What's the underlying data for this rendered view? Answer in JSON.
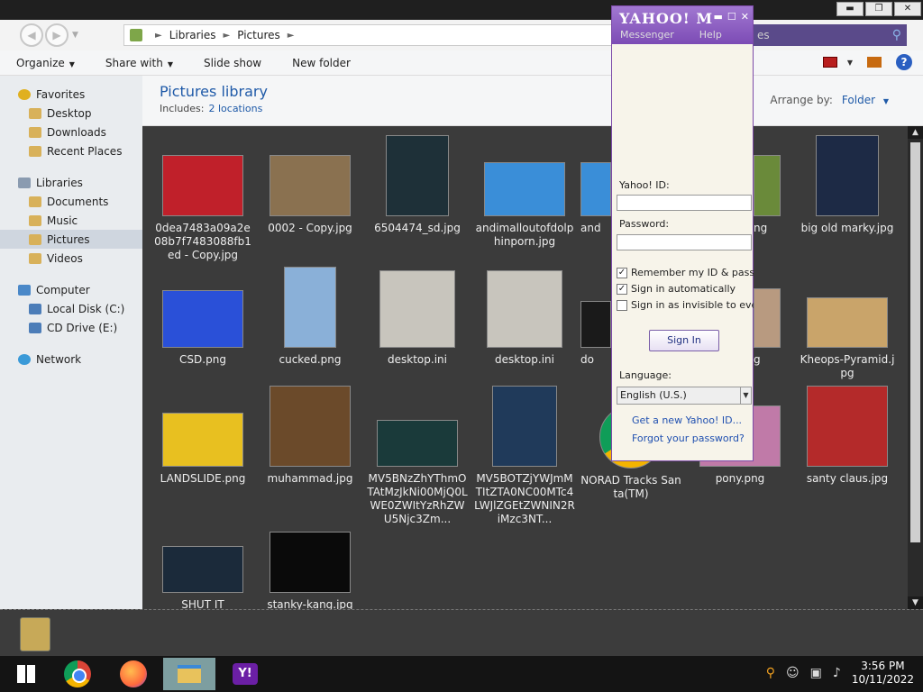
{
  "titlebar": {
    "minimize": "▬",
    "maximize": "❐",
    "close": "✕"
  },
  "address": {
    "crumbs": [
      "Libraries",
      "Pictures"
    ],
    "sep": "►"
  },
  "search": {
    "placeholder_tail": "es"
  },
  "toolbar": {
    "organize": "Organize",
    "share_with": "Share with",
    "slide_show": "Slide show",
    "new_folder": "New folder",
    "help": "?"
  },
  "sidebar": {
    "favorites": {
      "label": "Favorites",
      "items": [
        "Desktop",
        "Downloads",
        "Recent Places"
      ]
    },
    "libraries": {
      "label": "Libraries",
      "items": [
        "Documents",
        "Music",
        "Pictures",
        "Videos"
      ]
    },
    "computer": {
      "label": "Computer",
      "items": [
        "Local Disk (C:)",
        "CD Drive (E:)"
      ]
    },
    "network": {
      "label": "Network"
    }
  },
  "library": {
    "title": "Pictures library",
    "includes": "Includes:",
    "locations": "2 locations",
    "arrange_by": "Arrange by:",
    "arrange_value": "Folder"
  },
  "files": [
    {
      "name": "0dea7483a09a2e08b7f7483088fb1ed - Copy.jpg"
    },
    {
      "name": "0002 - Copy.jpg"
    },
    {
      "name": "6504474_sd.jpg"
    },
    {
      "name": "andimalloutofdolphinporn.jpg"
    },
    {
      "name": "and"
    },
    {
      "name": "ng"
    },
    {
      "name": "big old marky.jpg"
    },
    {
      "name": "CSD.png"
    },
    {
      "name": "cucked.png"
    },
    {
      "name": "desktop.ini"
    },
    {
      "name": "desktop.ini"
    },
    {
      "name": "do"
    },
    {
      "name": "g"
    },
    {
      "name": "Kheops-Pyramid.jpg"
    },
    {
      "name": "LANDSLIDE.png"
    },
    {
      "name": "muhammad.jpg"
    },
    {
      "name": "MV5BNzZhYThmOTAtMzJkNi00MjQ0LWE0ZWItYzRhZWU5Njc3Zm..."
    },
    {
      "name": "MV5BOTZjYWJmMTItZTA0NC00MTc4LWJlZGEtZWNIN2RiMzc3NT..."
    },
    {
      "name": "NORAD Tracks Santa(TM)"
    },
    {
      "name": "pony.png"
    },
    {
      "name": "santy claus.jpg"
    },
    {
      "name": "SHUT IT"
    },
    {
      "name": "stanky-kang.jpg"
    }
  ],
  "yahoo": {
    "brand": "YAHOO! M",
    "controls": [
      "▬",
      "☐",
      "✕"
    ],
    "menu": [
      "Messenger",
      "Help"
    ],
    "id_label": "Yahoo! ID:",
    "password_label": "Password:",
    "remember": "Remember my ID & passwor",
    "auto_signin": "Sign in automatically",
    "invisible": "Sign in as invisible to everyo",
    "check": "✓",
    "signin": "Sign In",
    "language_label": "Language:",
    "language_value": "English (U.S.)",
    "get_id": "Get a new Yahoo! ID...",
    "forgot": "Forgot your password?"
  },
  "taskbar": {
    "time": "3:56 PM",
    "date": "10/11/2022",
    "yahoo_icon": "Y!"
  }
}
